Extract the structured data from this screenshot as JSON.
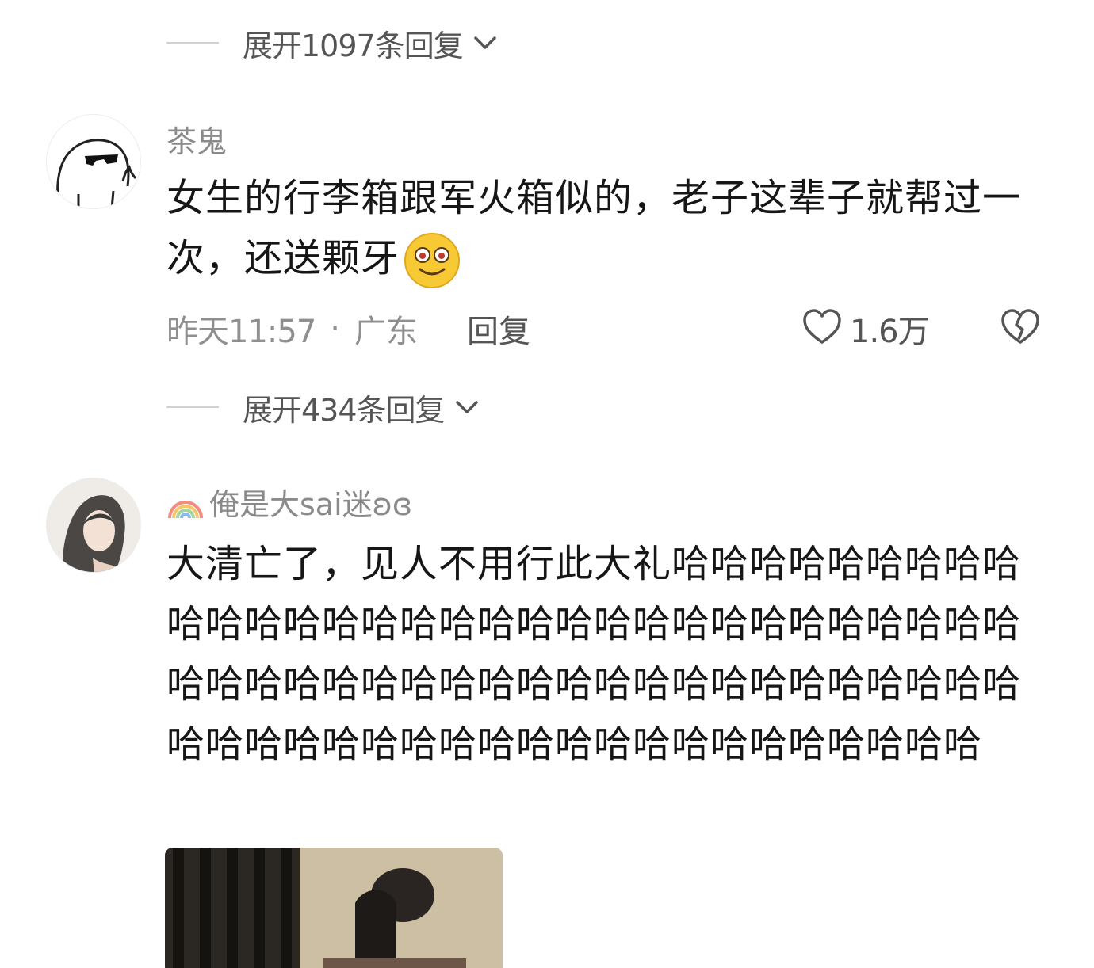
{
  "thread_top": {
    "expand_label": "展开1097条回复"
  },
  "comment1": {
    "username": "茶鬼",
    "avatar_icon": "sunglasses-cartoon-avatar",
    "text": "女生的行李箱跟军火箱似的，老子这辈子就帮过一次，还送颗牙",
    "emoji": "smile-emoji",
    "time": "昨天11:57",
    "dot": "·",
    "location": "广东",
    "reply_label": "回复",
    "like_count": "1.6万",
    "expand_label": "展开434条回复"
  },
  "comment2": {
    "username_prefix_icon": "rainbow-icon",
    "username": "俺是大sai迷ʚɞ",
    "avatar_icon": "anime-girl-avatar",
    "text": "大清亡了，见人不用行此大礼哈哈哈哈哈哈哈哈哈哈哈哈哈哈哈哈哈哈哈哈哈哈哈哈哈哈哈哈哈哈哈哈哈哈哈哈哈哈哈哈哈哈哈哈哈哈哈哈哈哈哈哈哈哈哈哈哈哈哈哈哈哈哈哈哈哈哈哈哈哈哈哈哈哈"
  },
  "colors": {
    "text_primary": "#161616",
    "text_secondary": "#8a8a8a",
    "divider": "#d2d2d2"
  }
}
